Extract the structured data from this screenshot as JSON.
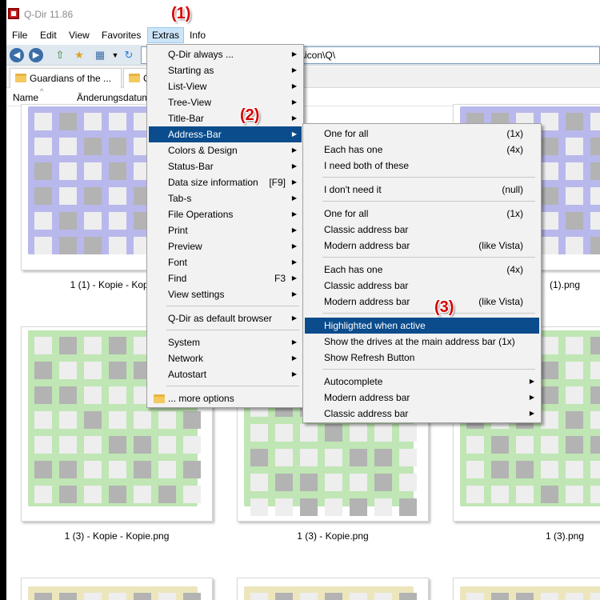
{
  "window": {
    "title": "Q-Dir 11.86"
  },
  "menubar": [
    "File",
    "Edit",
    "View",
    "Favorites",
    "Extras",
    "Info"
  ],
  "address": {
    "value": "g\\icon\\Q\\"
  },
  "tabs": [
    "Guardians of the ...",
    "C"
  ],
  "columns": {
    "name": "Name",
    "date": "Änderungsdatum"
  },
  "files": {
    "row1": [
      "1 (1) - Kopie - Kopi",
      "(1).png"
    ],
    "row2": [
      "1 (3) - Kopie - Kopie.png",
      "1 (3) - Kopie.png",
      "1 (3).png"
    ]
  },
  "extras_menu": [
    {
      "label": "Q-Dir always ...",
      "submenu": true
    },
    {
      "label": "Starting as",
      "submenu": true
    },
    {
      "label": "List-View",
      "submenu": true
    },
    {
      "label": "Tree-View",
      "submenu": true
    },
    {
      "label": "Title-Bar",
      "submenu": true
    },
    {
      "label": "Address-Bar",
      "submenu": true,
      "highlighted": true
    },
    {
      "label": "Colors & Design",
      "submenu": true
    },
    {
      "label": "Status-Bar",
      "submenu": true
    },
    {
      "label": "Data size information",
      "shortcut": "[F9]",
      "submenu": true
    },
    {
      "label": "Tab-s",
      "submenu": true
    },
    {
      "label": "File Operations",
      "submenu": true
    },
    {
      "label": "Print",
      "submenu": true
    },
    {
      "label": "Preview",
      "submenu": true
    },
    {
      "label": "Font",
      "submenu": true
    },
    {
      "label": "Find",
      "shortcut": "F3",
      "submenu": true
    },
    {
      "label": "View settings",
      "submenu": true
    },
    {
      "label": "Q-Dir as default browser",
      "submenu": true
    },
    {
      "label": "System",
      "submenu": true
    },
    {
      "label": "Network",
      "submenu": true
    },
    {
      "label": "Autostart",
      "submenu": true
    },
    {
      "label": "... more options",
      "submenu": false
    }
  ],
  "address_submenu": [
    {
      "label": "One for all",
      "hint": "(1x)"
    },
    {
      "label": "Each has one",
      "hint": "(4x)"
    },
    {
      "label": "I need both of these",
      "hint": ""
    },
    {
      "label": "I don't need it",
      "hint": "(null)"
    },
    {
      "label": "One for all",
      "hint": "(1x)"
    },
    {
      "label": "Classic address bar",
      "hint": ""
    },
    {
      "label": "Modern address bar",
      "hint": "(like Vista)"
    },
    {
      "label": "Each has one",
      "hint": "(4x)"
    },
    {
      "label": "Classic address bar",
      "hint": ""
    },
    {
      "label": "Modern address bar",
      "hint": "(like Vista)"
    },
    {
      "label": "Highlighted when active",
      "hint": "",
      "highlighted": true
    },
    {
      "label": "Show the drives at the main address bar (1x)",
      "hint": ""
    },
    {
      "label": "Show Refresh Button",
      "hint": ""
    },
    {
      "label": "Autocomplete",
      "submenu": true
    },
    {
      "label": "Modern address bar",
      "submenu": true
    },
    {
      "label": "Classic address bar",
      "submenu": true
    }
  ],
  "annotations": [
    "(1)",
    "(2)",
    "(3)"
  ],
  "colors": {
    "menu_highlight": "#0a4c8c",
    "annotation": "#d40000",
    "thumb_blue": "#b9b8ec",
    "thumb_green": "#bfe6b4",
    "thumb_yellow": "#ede6bd"
  }
}
